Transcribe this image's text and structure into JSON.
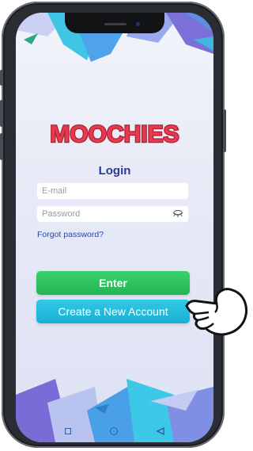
{
  "app": {
    "logo_text": "MOOCHIES"
  },
  "login": {
    "title": "Login",
    "email_placeholder": "E-mail",
    "password_placeholder": "Password",
    "forgot_label": "Forgot password?"
  },
  "buttons": {
    "enter_label": "Enter",
    "create_label": "Create a New Account"
  },
  "icons": {
    "password_toggle": "eye-closed-icon",
    "pointer": "hand-pointer-icon",
    "nav_back": "triangle-back-icon",
    "nav_home": "circle-home-icon",
    "nav_recent": "square-recent-icon"
  },
  "colors": {
    "title": "#2b3a8f",
    "link": "#2b46a3",
    "enter_button": "#2fc35f",
    "create_button": "#22bcdb",
    "logo_fill": "#e63a4e",
    "phone_frame": "#2a2d33"
  }
}
